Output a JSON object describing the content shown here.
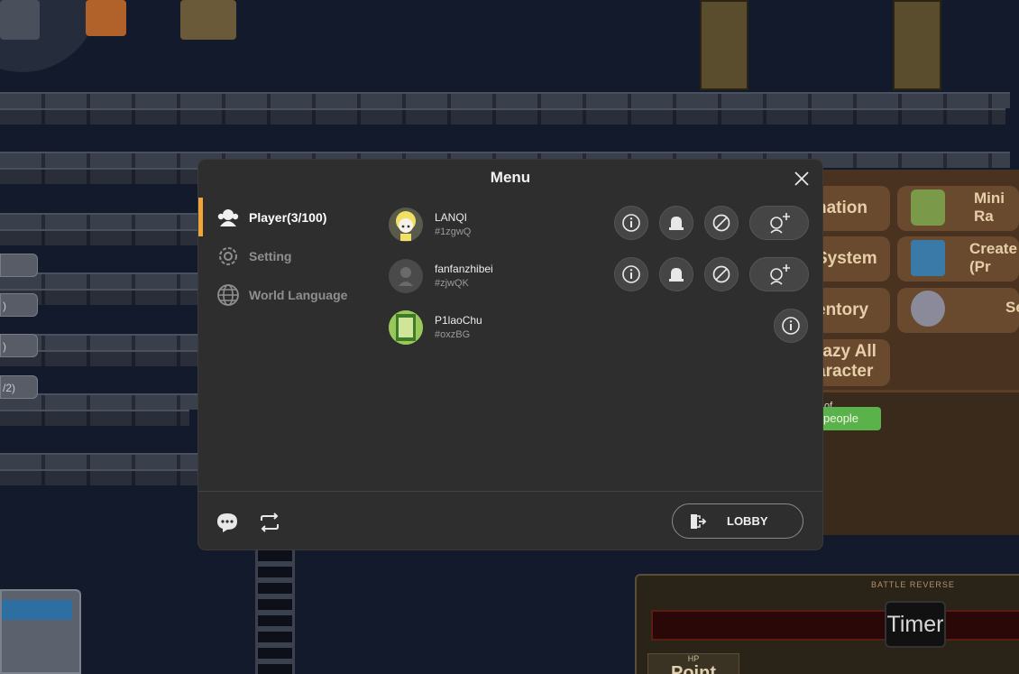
{
  "menu": {
    "title": "Menu",
    "close_icon": "close-icon"
  },
  "sidebar": {
    "items": [
      {
        "label": "Player(3/100)",
        "icon": "players-icon",
        "active": true
      },
      {
        "label": "Setting",
        "icon": "gear-icon",
        "active": false
      },
      {
        "label": "World Language",
        "icon": "globe-icon",
        "active": false
      }
    ]
  },
  "players": [
    {
      "name": "LANQI",
      "tag": "#1zgwQ",
      "actions": [
        "info-icon",
        "bell-icon",
        "block-icon",
        "add-friend-icon"
      ]
    },
    {
      "name": "fanfanzhibei",
      "tag": "#zjwQK",
      "actions": [
        "info-icon",
        "bell-icon",
        "block-icon",
        "add-friend-icon"
      ]
    },
    {
      "name": "P1laoChu",
      "tag": "#oxzBG",
      "actions": [
        "info-icon"
      ]
    }
  ],
  "footer": {
    "chat_icon": "chat-icon",
    "refresh_icon": "refresh-icon",
    "lobby_label": "LOBBY",
    "lobby_icon": "exit-icon"
  },
  "background": {
    "right_panel": [
      "nation",
      "System",
      "entory",
      "razy All\naracter"
    ],
    "right_panel_2": [
      "Mini\nRa",
      "Create\n(Pr",
      "Se"
    ],
    "badge_text": "people",
    "badge_prefix": "of",
    "left_buttons": [
      ")",
      ")",
      "/2)"
    ],
    "battle_label": "BATTLE REVERSE",
    "timer_label": "Timer",
    "hp_label": "HP",
    "point_label": "Point"
  },
  "colors": {
    "accent": "#f0a53a",
    "menu_bg": "#2e2e2e"
  }
}
